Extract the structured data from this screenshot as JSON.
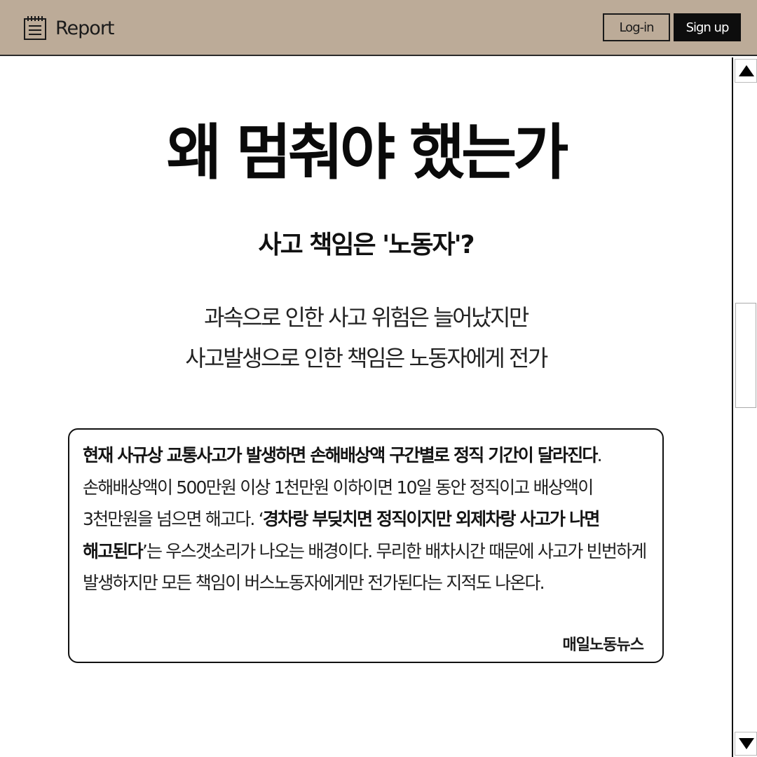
{
  "header": {
    "brand_icon": "notepad-icon",
    "brand_text": "Report",
    "login_label": "Log-in",
    "signup_label": "Sign up",
    "bg_color": "#bcab98"
  },
  "main": {
    "title": "왜 멈춰야 했는가",
    "subtitle": "사고 책임은 '노동자'?",
    "summary_lines": [
      "과속으로 인한 사고 위험은 늘어났지만",
      "사고발생으로 인한 책임은 노동자에게 전가"
    ]
  },
  "quote": {
    "bold_1": "현재 사규상 교통사고가 발생하면 손해배상액 구간별로 정직 기간이 달라진다",
    "text_1": ". 손해배상액이 500만원 이상 1천만원 이하이면 10일 동안 정직이고 배상액이 3천만원을 넘으면 해고다. ‘",
    "bold_2": "경차랑 부딪치면 정직이지만 외제차랑 사고가 나면 해고된다",
    "text_2": "’는 우스갯소리가 나오는 배경이다. 무리한 배차시간 때문에 사고가 빈번하게 발생하지만 모든 책임이 버스노동자에게만 전가된다는 지적도 나온다.",
    "source": "매일노동뉴스"
  },
  "scrollbar": {
    "up_icon": "arrow-up-icon",
    "down_icon": "arrow-down-icon"
  }
}
